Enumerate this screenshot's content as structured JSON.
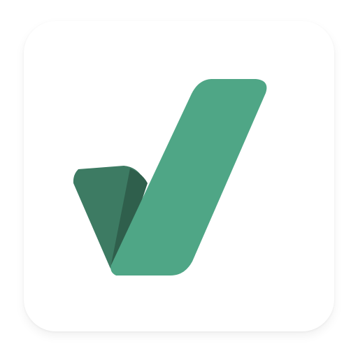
{
  "app_icon": {
    "symbol": "checkmark-icon",
    "colors": {
      "tile": "#ffffff",
      "long_stroke": "#4fa686",
      "short_stroke": "#3d7b63",
      "fold_shadow": "#2f5f4c"
    }
  }
}
